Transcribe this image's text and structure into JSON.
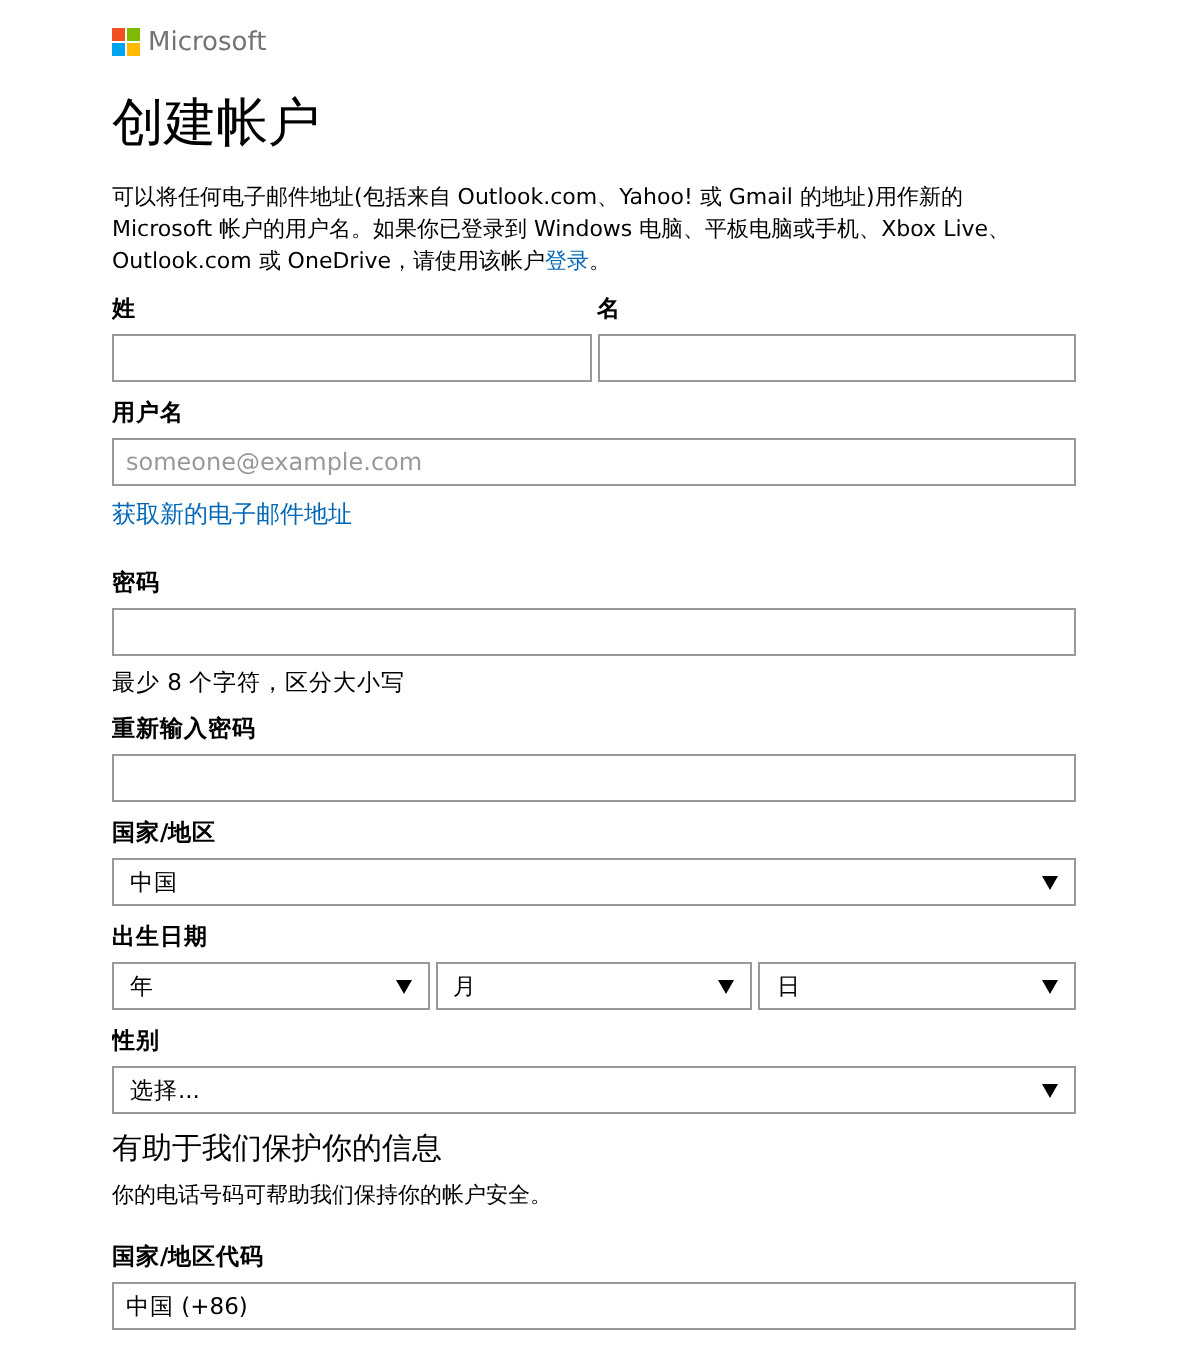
{
  "brand": {
    "name": "Microsoft"
  },
  "title": "创建帐户",
  "intro": {
    "text": "可以将任何电子邮件地址(包括来自 Outlook.com、Yahoo! 或 Gmail 的地址)用作新的 Microsoft 帐户的用户名。如果你已登录到 Windows 电脑、平板电脑或手机、Xbox Live、Outlook.com 或 OneDrive，请使用该帐户",
    "link": "登录",
    "end": "。"
  },
  "items": [
    {
      "kind": "name_row",
      "fields": [
        {
          "label": "姓"
        },
        {
          "label": "名"
        }
      ]
    },
    {
      "kind": "label",
      "text": "用户名"
    },
    {
      "kind": "input",
      "placeholder": "someone@example.com"
    },
    {
      "kind": "link",
      "text": "获取新的电子邮件地址"
    },
    {
      "kind": "label",
      "text": "密码"
    },
    {
      "kind": "input"
    },
    {
      "kind": "hint",
      "text": "最少 8 个字符，区分大小写"
    },
    {
      "kind": "label",
      "text": "重新输入密码"
    },
    {
      "kind": "input"
    },
    {
      "kind": "label",
      "text": "国家/地区"
    },
    {
      "kind": "select",
      "value": "中国"
    },
    {
      "kind": "label",
      "text": "出生日期"
    },
    {
      "kind": "select_row",
      "selects": [
        {
          "value": "年"
        },
        {
          "value": "月"
        },
        {
          "value": "日"
        }
      ]
    },
    {
      "kind": "label",
      "text": "性别"
    },
    {
      "kind": "select",
      "value": "选择..."
    },
    {
      "kind": "heading",
      "text": "有助于我们保护你的信息"
    },
    {
      "kind": "note",
      "text": "你的电话号码可帮助我们保持你的帐户安全。"
    },
    {
      "kind": "label",
      "text": "国家/地区代码"
    },
    {
      "kind": "input",
      "value": "中国 (+86)"
    }
  ]
}
